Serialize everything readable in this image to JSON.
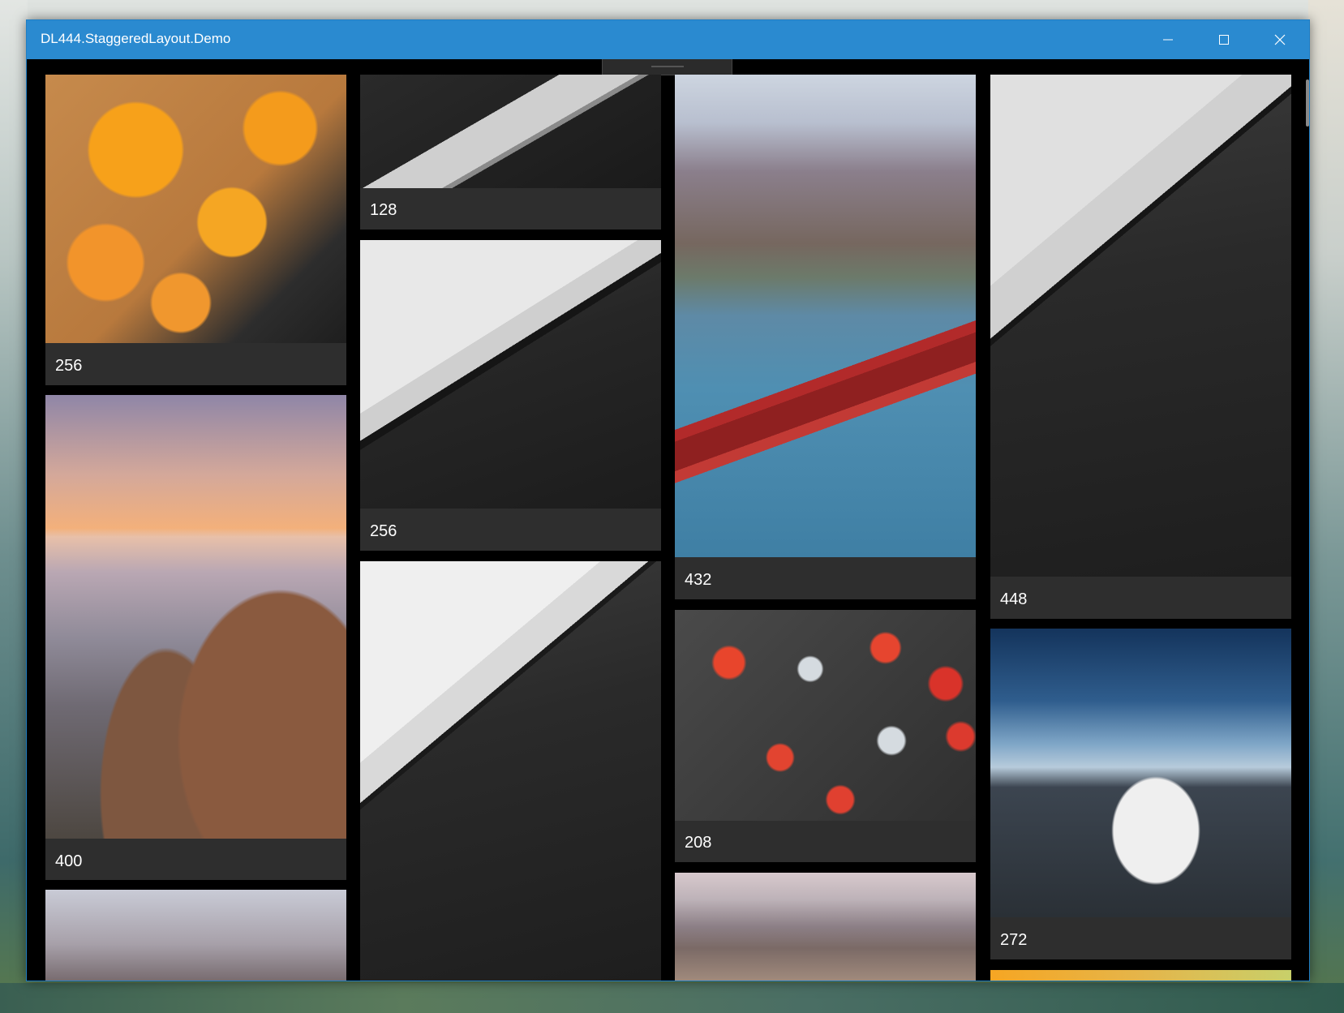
{
  "window": {
    "title": "DL444.StaggeredLayout.Demo",
    "accent_color": "#2a8ad0"
  },
  "icons": {
    "minimize": "minimize-icon",
    "maximize": "maximize-icon",
    "close": "close-icon"
  },
  "grid": {
    "cards": [
      {
        "caption": "256",
        "image": "orange-drinks-photo"
      },
      {
        "caption": "400",
        "image": "monaco-coastline-photo"
      },
      {
        "caption": "",
        "image": "golden-gate-bridge-photo"
      },
      {
        "caption": "128",
        "image": "laptop-phone-photo"
      },
      {
        "caption": "256",
        "image": "laptop-phone-photo"
      },
      {
        "caption": "",
        "image": "laptop-closeup-photo"
      },
      {
        "caption": "432",
        "image": "golden-gate-bridge-photo"
      },
      {
        "caption": "208",
        "image": "strawberries-blueberries-photo"
      },
      {
        "caption": "",
        "image": "monaco-coastline-photo"
      },
      {
        "caption": "448",
        "image": "laptop-closeup-photo"
      },
      {
        "caption": "272",
        "image": "snowy-mountain-photo"
      },
      {
        "caption": "",
        "image": "orange-drinks-photo"
      }
    ]
  }
}
